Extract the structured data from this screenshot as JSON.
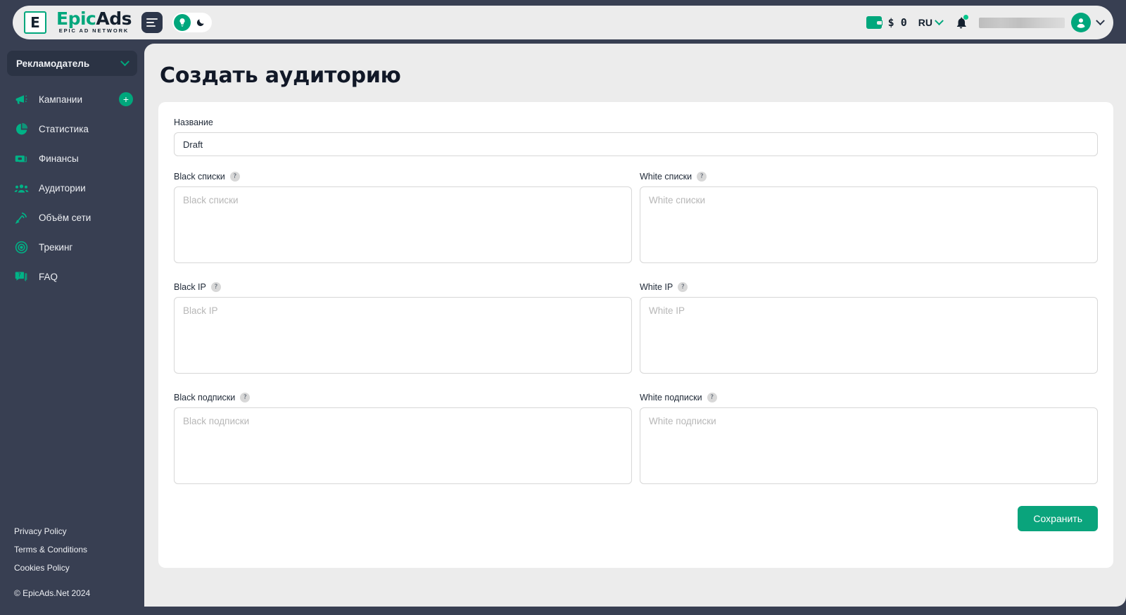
{
  "brand": {
    "mark": "E",
    "name_part1": "Epic",
    "name_part2": "Ads",
    "tagline": "EPIC AD NETWORK",
    "accent": "#00A77C",
    "dark": "#383F52"
  },
  "header": {
    "menu_icon": "menu-icon",
    "theme": {
      "light_icon": "lightbulb-icon",
      "dark_icon": "moon-icon",
      "active": "light"
    },
    "balance": {
      "icon": "wallet-icon",
      "amount": "$ 0"
    },
    "language": {
      "label": "RU",
      "icon": "chevron-down-icon"
    },
    "notifications": {
      "icon": "bell-icon",
      "has_unread": true
    },
    "user": {
      "name_masked": true,
      "avatar_icon": "user-avatar-icon",
      "chevron": "chevron-down-icon"
    }
  },
  "sidebar": {
    "role_selector": {
      "label": "Рекламодатель",
      "icon": "chevron-down-icon"
    },
    "items": [
      {
        "label": "Кампании",
        "icon": "megaphone-icon",
        "action": "+"
      },
      {
        "label": "Статистика",
        "icon": "pie-chart-icon"
      },
      {
        "label": "Финансы",
        "icon": "money-icon"
      },
      {
        "label": "Аудитории",
        "icon": "users-icon"
      },
      {
        "label": "Объём сети",
        "icon": "signal-icon"
      },
      {
        "label": "Трекинг",
        "icon": "target-icon"
      },
      {
        "label": "FAQ",
        "icon": "question-chat-icon"
      }
    ],
    "footer_links": [
      "Privacy Policy",
      "Terms & Conditions",
      "Cookies Policy"
    ],
    "copyright": "© EpicAds.Net 2024"
  },
  "main": {
    "title": "Создать аудиторию",
    "form": {
      "name": {
        "label": "Название",
        "value": "Draft",
        "placeholder": "Название"
      },
      "fields": [
        {
          "label": "Black списки",
          "placeholder": "Black списки",
          "value": "",
          "help": "?"
        },
        {
          "label": "White списки",
          "placeholder": "White списки",
          "value": "",
          "help": "?"
        },
        {
          "label": "Black IP",
          "placeholder": "Black IP",
          "value": "",
          "help": "?"
        },
        {
          "label": "White IP",
          "placeholder": "White IP",
          "value": "",
          "help": "?"
        },
        {
          "label": "Black подписки",
          "placeholder": "Black подписки",
          "value": "",
          "help": "?"
        },
        {
          "label": "White подписки",
          "placeholder": "White подписки",
          "value": "",
          "help": "?"
        }
      ],
      "save_label": "Сохранить"
    }
  }
}
